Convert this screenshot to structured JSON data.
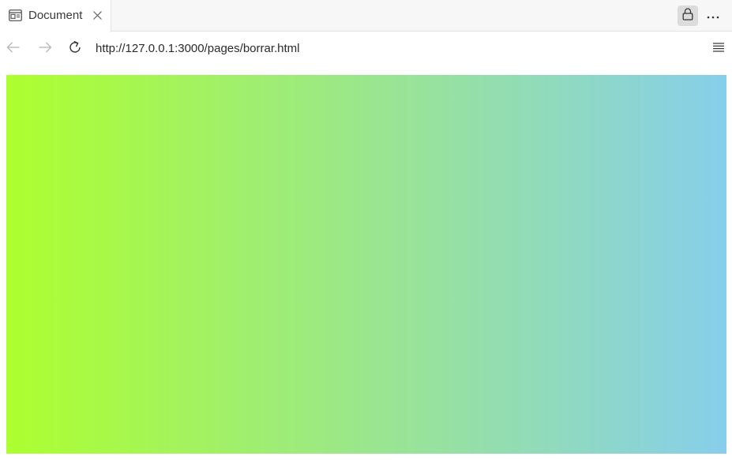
{
  "tab": {
    "title": "Document",
    "icon": "page-icon",
    "close_icon": "close-icon"
  },
  "toolbar": {
    "lock_icon": "lock-icon",
    "more_icon": "more-horizontal-icon"
  },
  "navigation": {
    "back_icon": "arrow-left-icon",
    "forward_icon": "arrow-right-icon",
    "reload_icon": "reload-icon",
    "url": "http://127.0.0.1:3000/pages/borrar.html",
    "menu_icon": "hamburger-menu-icon"
  },
  "page": {
    "gradient_start": "#adff2f",
    "gradient_end": "#87ceeb"
  }
}
